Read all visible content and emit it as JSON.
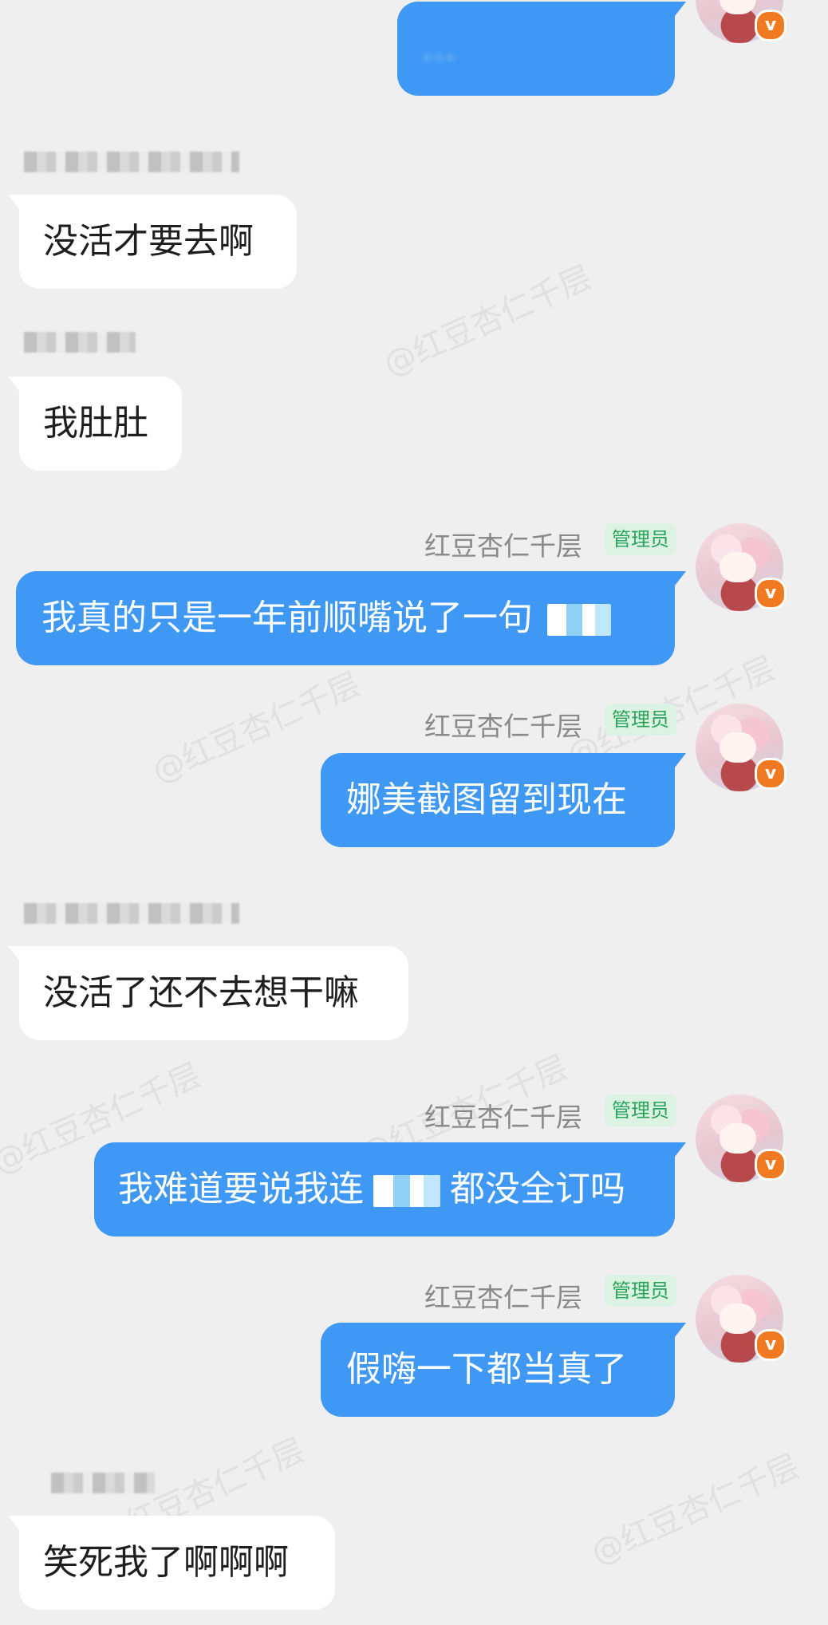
{
  "watermarks": [
    "@红豆杏仁千层",
    "@红豆杏仁千层",
    "@红豆杏仁千层",
    "@红豆杏仁千层",
    "@红豆杏仁千层",
    "@红豆杏仁千层",
    "@红豆杏仁千层"
  ],
  "colors": {
    "background": "#efefef",
    "mine_bubble": "#3e98f4",
    "their_bubble": "#ffffff",
    "admin_badge_bg": "#dcf2e2",
    "admin_badge_text": "#28a35a",
    "verified_badge": "#f07a22"
  },
  "messages": [
    {
      "from": "me",
      "text": "…"
    },
    {
      "from": "other",
      "text": "没活才要去啊"
    },
    {
      "from": "other",
      "text": "我肚肚"
    },
    {
      "from": "me",
      "sender": "红豆杏仁千层",
      "badge": "管理员",
      "text": "我真的只是一年前顺嘴说了一句"
    },
    {
      "from": "me",
      "sender": "红豆杏仁千层",
      "badge": "管理员",
      "text": "娜美截图留到现在"
    },
    {
      "from": "other",
      "text": "没活了还不去想干嘛"
    },
    {
      "from": "me",
      "sender": "红豆杏仁千层",
      "badge": "管理员",
      "text_before": "我难道要说我连",
      "text_after": "都没全订吗"
    },
    {
      "from": "me",
      "sender": "红豆杏仁千层",
      "badge": "管理员",
      "text": "假嗨一下都当真了"
    },
    {
      "from": "other",
      "text": "笑死我了啊啊啊"
    }
  ],
  "avatar": {
    "icon": "anime-girl-avatar",
    "badge_icon": "verified-v-icon",
    "badge_glyph": "v"
  }
}
